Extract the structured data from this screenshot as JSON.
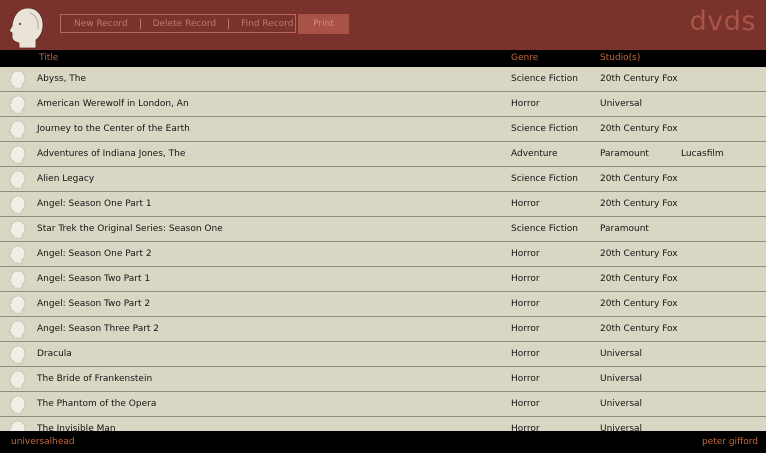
{
  "app": {
    "title": "dvds"
  },
  "toolbar": {
    "new_label": "New Record",
    "delete_label": "Delete Record",
    "find_label": "Find Record",
    "print_label": "Print"
  },
  "columns": {
    "title": "Title",
    "genre": "Genre",
    "studio": "Studio(s)"
  },
  "rows": [
    {
      "title": "Abyss, The",
      "genre": "Science Fiction",
      "studio": "20th Century Fox",
      "studio2": ""
    },
    {
      "title": "American Werewolf in London, An",
      "genre": "Horror",
      "studio": "Universal",
      "studio2": ""
    },
    {
      "title": "Journey to the Center of the Earth",
      "genre": "Science Fiction",
      "studio": "20th Century Fox",
      "studio2": ""
    },
    {
      "title": "Adventures of Indiana Jones, The",
      "genre": "Adventure",
      "studio": "Paramount",
      "studio2": "Lucasfilm"
    },
    {
      "title": "Alien Legacy",
      "genre": "Science Fiction",
      "studio": "20th Century Fox",
      "studio2": ""
    },
    {
      "title": "Angel: Season One Part 1",
      "genre": "Horror",
      "studio": "20th Century Fox",
      "studio2": ""
    },
    {
      "title": "Star Trek the Original Series: Season One",
      "genre": "Science Fiction",
      "studio": "Paramount",
      "studio2": ""
    },
    {
      "title": "Angel: Season One Part 2",
      "genre": "Horror",
      "studio": "20th Century Fox",
      "studio2": ""
    },
    {
      "title": "Angel: Season Two Part 1",
      "genre": "Horror",
      "studio": "20th Century Fox",
      "studio2": ""
    },
    {
      "title": "Angel: Season Two Part 2",
      "genre": "Horror",
      "studio": "20th Century Fox",
      "studio2": ""
    },
    {
      "title": "Angel: Season Three Part 2",
      "genre": "Horror",
      "studio": "20th Century Fox",
      "studio2": ""
    },
    {
      "title": "Dracula",
      "genre": "Horror",
      "studio": "Universal",
      "studio2": ""
    },
    {
      "title": "The Bride of Frankenstein",
      "genre": "Horror",
      "studio": "Universal",
      "studio2": ""
    },
    {
      "title": "The Phantom of the Opera",
      "genre": "Horror",
      "studio": "Universal",
      "studio2": ""
    },
    {
      "title": "The Invisible Man",
      "genre": "Horror",
      "studio": "Universal",
      "studio2": ""
    }
  ],
  "footer": {
    "left": "universalhead",
    "right": "peter gifford"
  },
  "colors": {
    "header": "#7a332c",
    "accent": "#c4683c",
    "row_bg": "#d9d6c4"
  }
}
